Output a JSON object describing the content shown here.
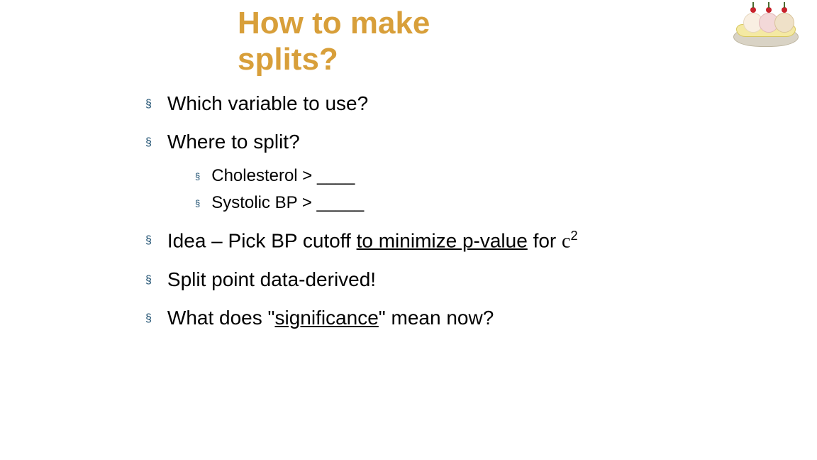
{
  "title_line1": "How to make",
  "title_line2": "splits?",
  "points": {
    "p1": "Which variable to use?",
    "p2": "Where to split?",
    "sub1": "Cholesterol  > ____",
    "sub2": "Systolic BP > _____",
    "p3_a": "Idea – Pick BP cutoff  ",
    "p3_u": "to minimize p-value",
    "p3_b": "  for ",
    "p3_chi": "c",
    "p3_sup": "2",
    "p4": "Split point data-derived!",
    "p5_a": "What does \"",
    "p5_u": "significance",
    "p5_b": "\" mean now?"
  },
  "image_alt": "banana-split"
}
